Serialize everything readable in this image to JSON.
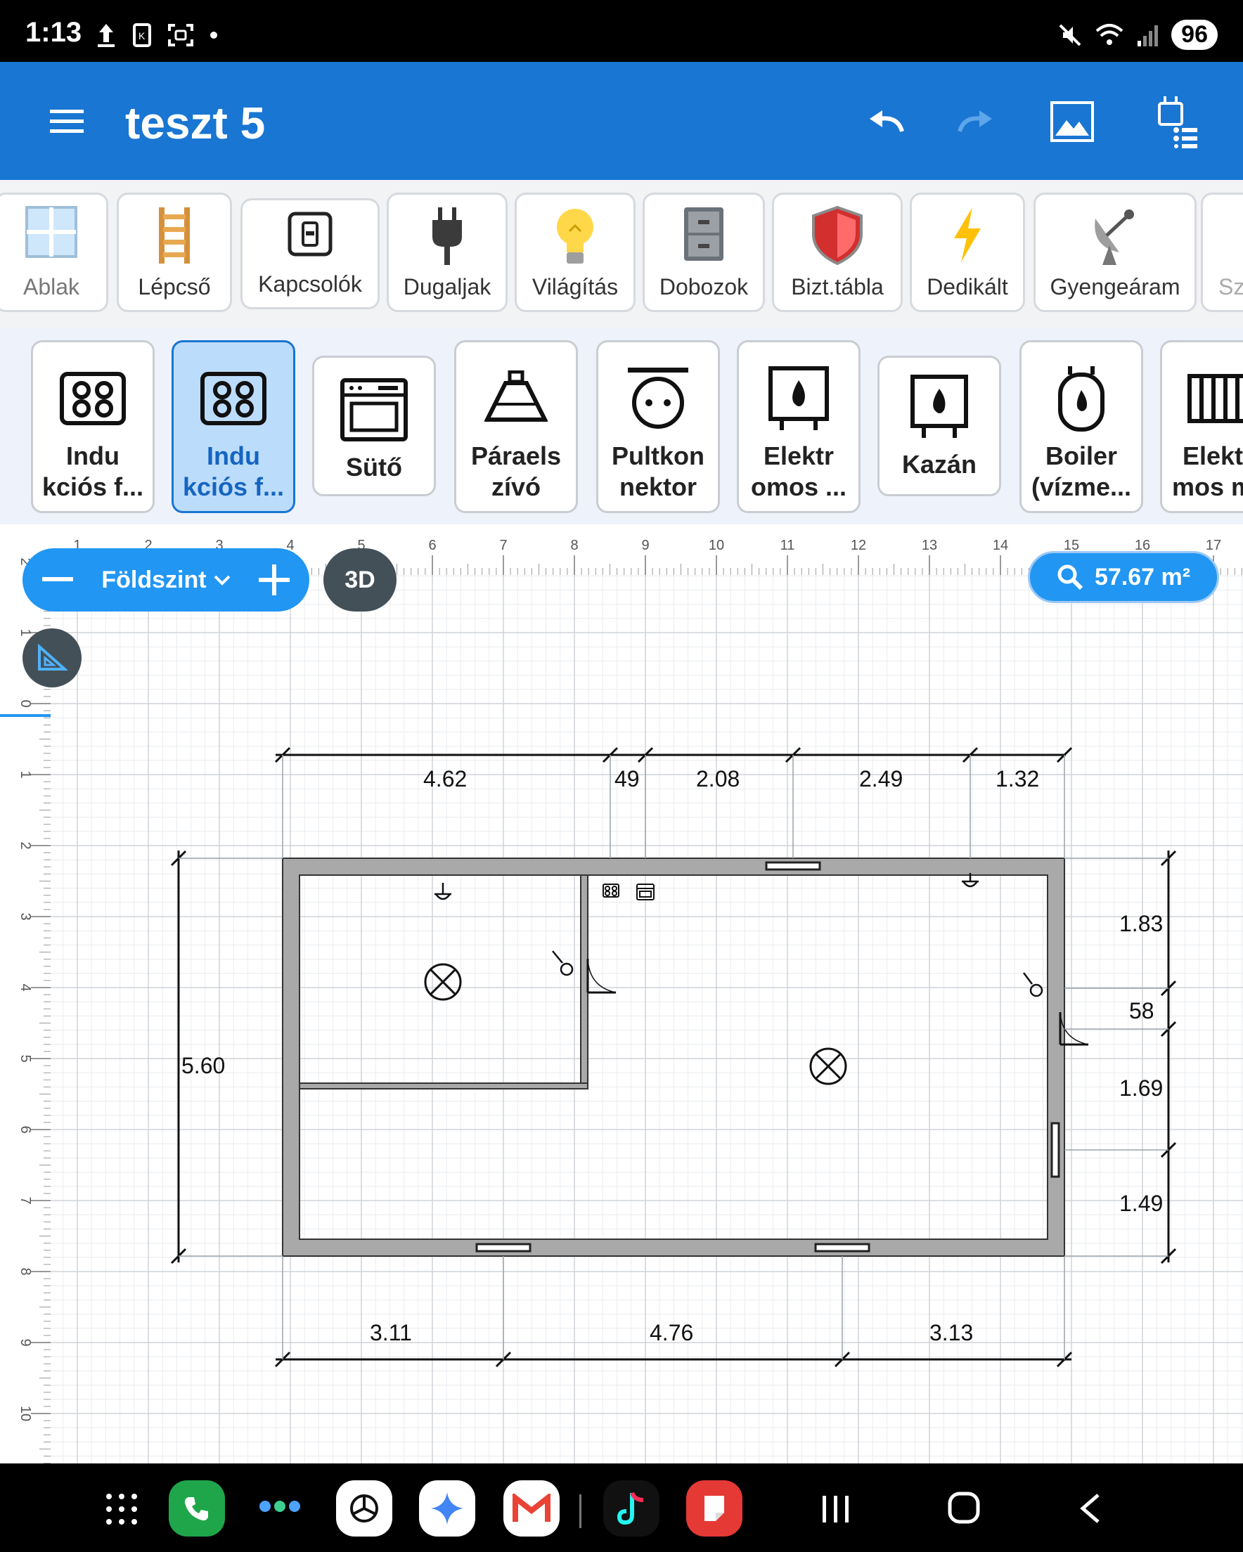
{
  "status": {
    "time": "1:13",
    "battery": "96"
  },
  "appbar": {
    "title": "teszt 5"
  },
  "categories": [
    "Ablak",
    "Lépcső",
    "Kapcsolók",
    "Dugaljak",
    "Világítás",
    "Dobozok",
    "Bizt.tábla",
    "Dedikált",
    "Gyengeáram",
    "Sz"
  ],
  "items": [
    "Indu\nkciós f...",
    "Indu\nkciós f...",
    "Sütő",
    "Páraels\nzívó",
    "Pultkon\nnektor",
    "Elektr\nomos ...",
    "Kazán",
    "Boiler\n(vízme...",
    "Elekt\nmos m"
  ],
  "canvas": {
    "floor": "Földszint",
    "view3d": "3D",
    "area": "57.67 m²",
    "ruler_top": [
      "1",
      "2",
      "3",
      "4",
      "5",
      "6",
      "7",
      "8",
      "9",
      "10",
      "11",
      "12",
      "13",
      "14",
      "15",
      "16",
      "17"
    ],
    "ruler_left": [
      "2",
      "1",
      "0",
      "1",
      "2",
      "3",
      "4",
      "5",
      "6",
      "7",
      "8",
      "9",
      "10"
    ],
    "dims_top": [
      "4.62",
      "49",
      "2.08",
      "2.49",
      "1.32"
    ],
    "dims_bottom": [
      "3.11",
      "4.76",
      "3.13"
    ],
    "dims_right": [
      "1.83",
      "58",
      "1.69",
      "1.49"
    ],
    "dim_left": "5.60"
  },
  "colors": {
    "accent": "#1976d2",
    "pill": "#2196f3",
    "dark_button": "#445058",
    "wall": "#a9a9a9"
  }
}
